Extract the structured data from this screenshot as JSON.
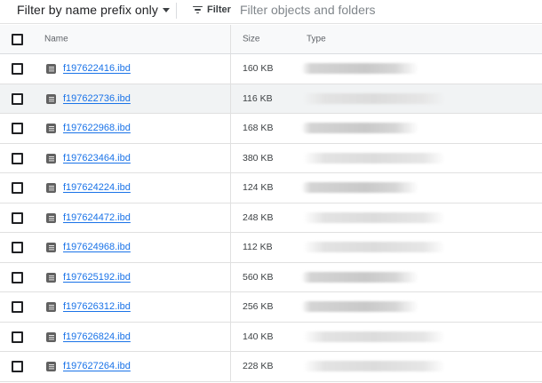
{
  "toolbar": {
    "prefix_filter_label": "Filter by name prefix only",
    "filter_label": "Filter",
    "filter_placeholder": "Filter objects and folders"
  },
  "table": {
    "columns": {
      "name": "Name",
      "size": "Size",
      "type": "Type"
    },
    "rows": [
      {
        "name": "f197622416.ibd",
        "size": "160 KB",
        "type": ""
      },
      {
        "name": "f197622736.ibd",
        "size": "116 KB",
        "type": ""
      },
      {
        "name": "f197622968.ibd",
        "size": "168 KB",
        "type": ""
      },
      {
        "name": "f197623464.ibd",
        "size": "380 KB",
        "type": ""
      },
      {
        "name": "f197624224.ibd",
        "size": "124 KB",
        "type": ""
      },
      {
        "name": "f197624472.ibd",
        "size": "248 KB",
        "type": ""
      },
      {
        "name": "f197624968.ibd",
        "size": "112 KB",
        "type": ""
      },
      {
        "name": "f197625192.ibd",
        "size": "560 KB",
        "type": ""
      },
      {
        "name": "f197626312.ibd",
        "size": "256 KB",
        "type": ""
      },
      {
        "name": "f197626824.ibd",
        "size": "140 KB",
        "type": ""
      },
      {
        "name": "f197627264.ibd",
        "size": "228 KB",
        "type": ""
      }
    ]
  },
  "icons": {
    "file": "file-icon",
    "filter": "filter-icon",
    "dropdown": "chevron-down-icon"
  },
  "colors": {
    "link": "#1a73e8",
    "header_bg": "#f8f9fa",
    "hover_row_bg": "#f1f3f4",
    "icon": "#616161"
  }
}
